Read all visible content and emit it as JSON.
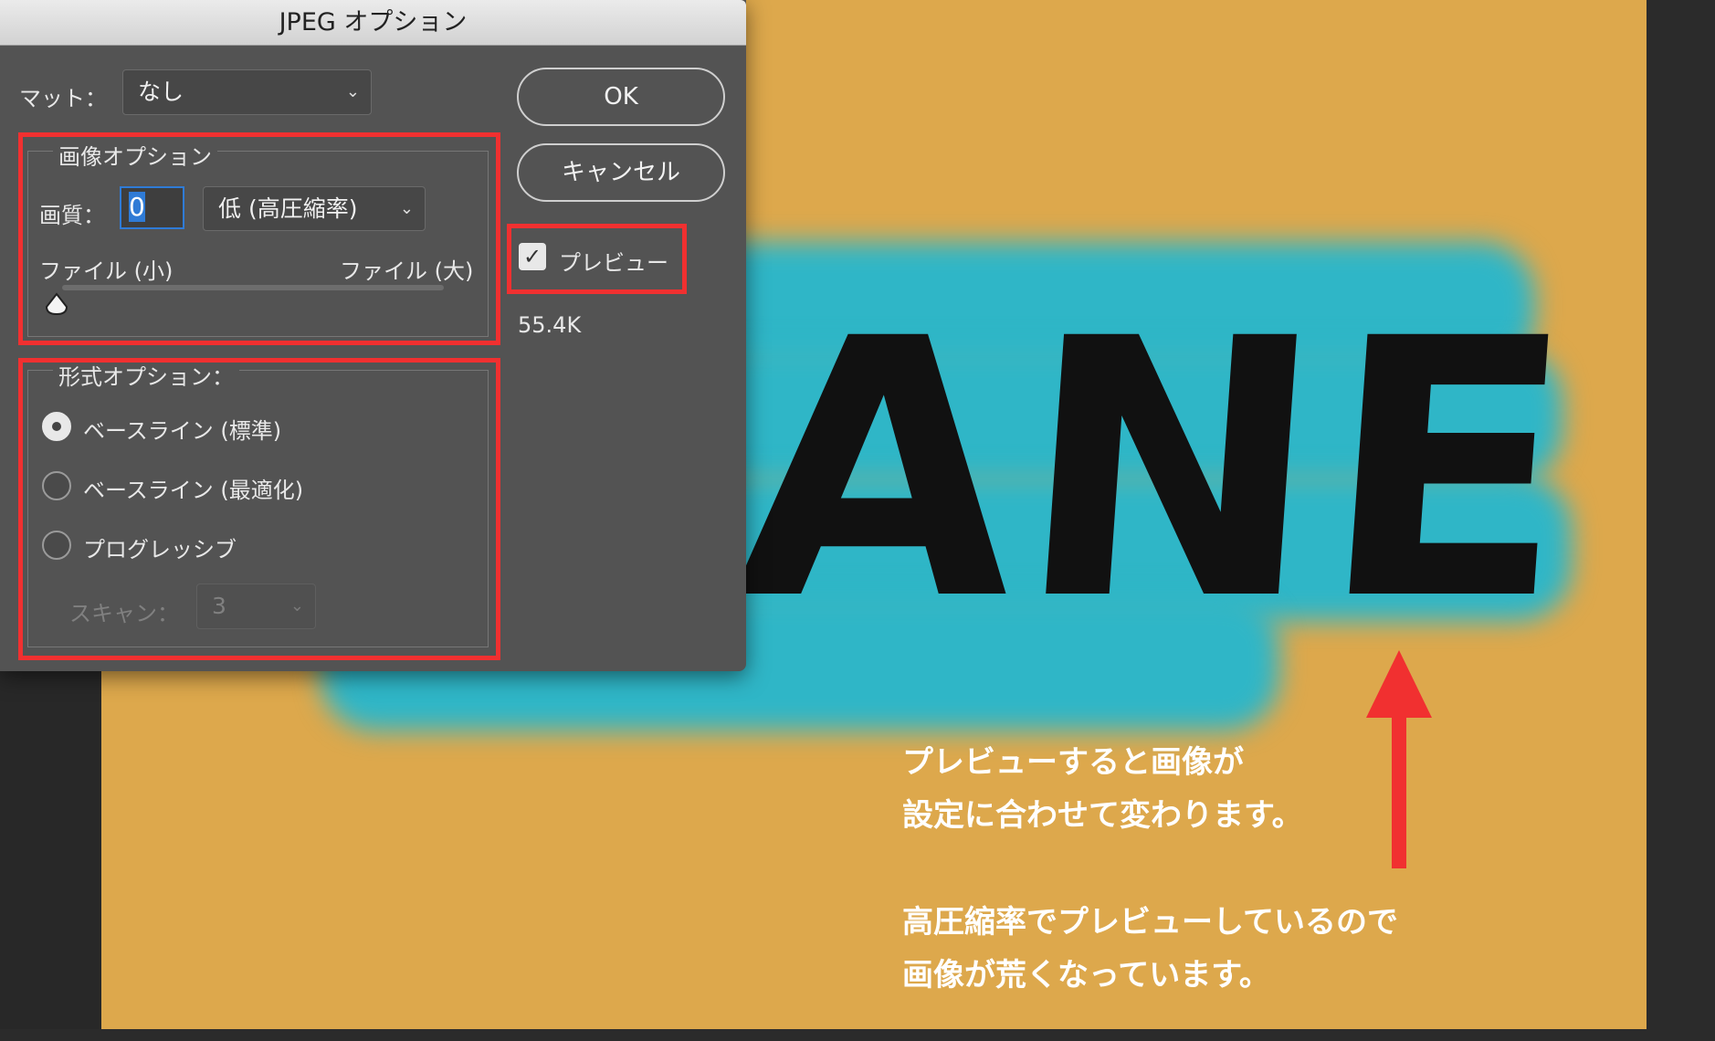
{
  "dialog": {
    "title": "JPEG オプション",
    "matte_label": "マット：",
    "matte_value": "なし",
    "image_options": {
      "title": "画像オプション",
      "quality_label": "画質：",
      "quality_value": "0",
      "quality_preset": "低 (高圧縮率)",
      "slider_min_label": "ファイル (小)",
      "slider_max_label": "ファイル (大)",
      "slider_level": 0
    },
    "format_options": {
      "title": "形式オプション：",
      "options": [
        "ベースライン (標準)",
        "ベースライン (最適化)",
        "プログレッシブ"
      ],
      "selected": 0,
      "scan_label": "スキャン：",
      "scan_value": "3"
    },
    "ok_label": "OK",
    "cancel_label": "キャンセル",
    "preview_label": "プレビュー",
    "preview_checked": true,
    "file_size": "55.4K"
  },
  "canvas": {
    "art_text": "ANE",
    "note1_line1": "プレビューすると画像が",
    "note1_line2": "設定に合わせて変わります。",
    "note2_line1": "高圧縮率でプレビューしているので",
    "note2_line2": "画像が荒くなっています。",
    "background_color": "#dda84c",
    "stroke_color": "#2fb6c7",
    "highlight_color": "#f13030"
  }
}
